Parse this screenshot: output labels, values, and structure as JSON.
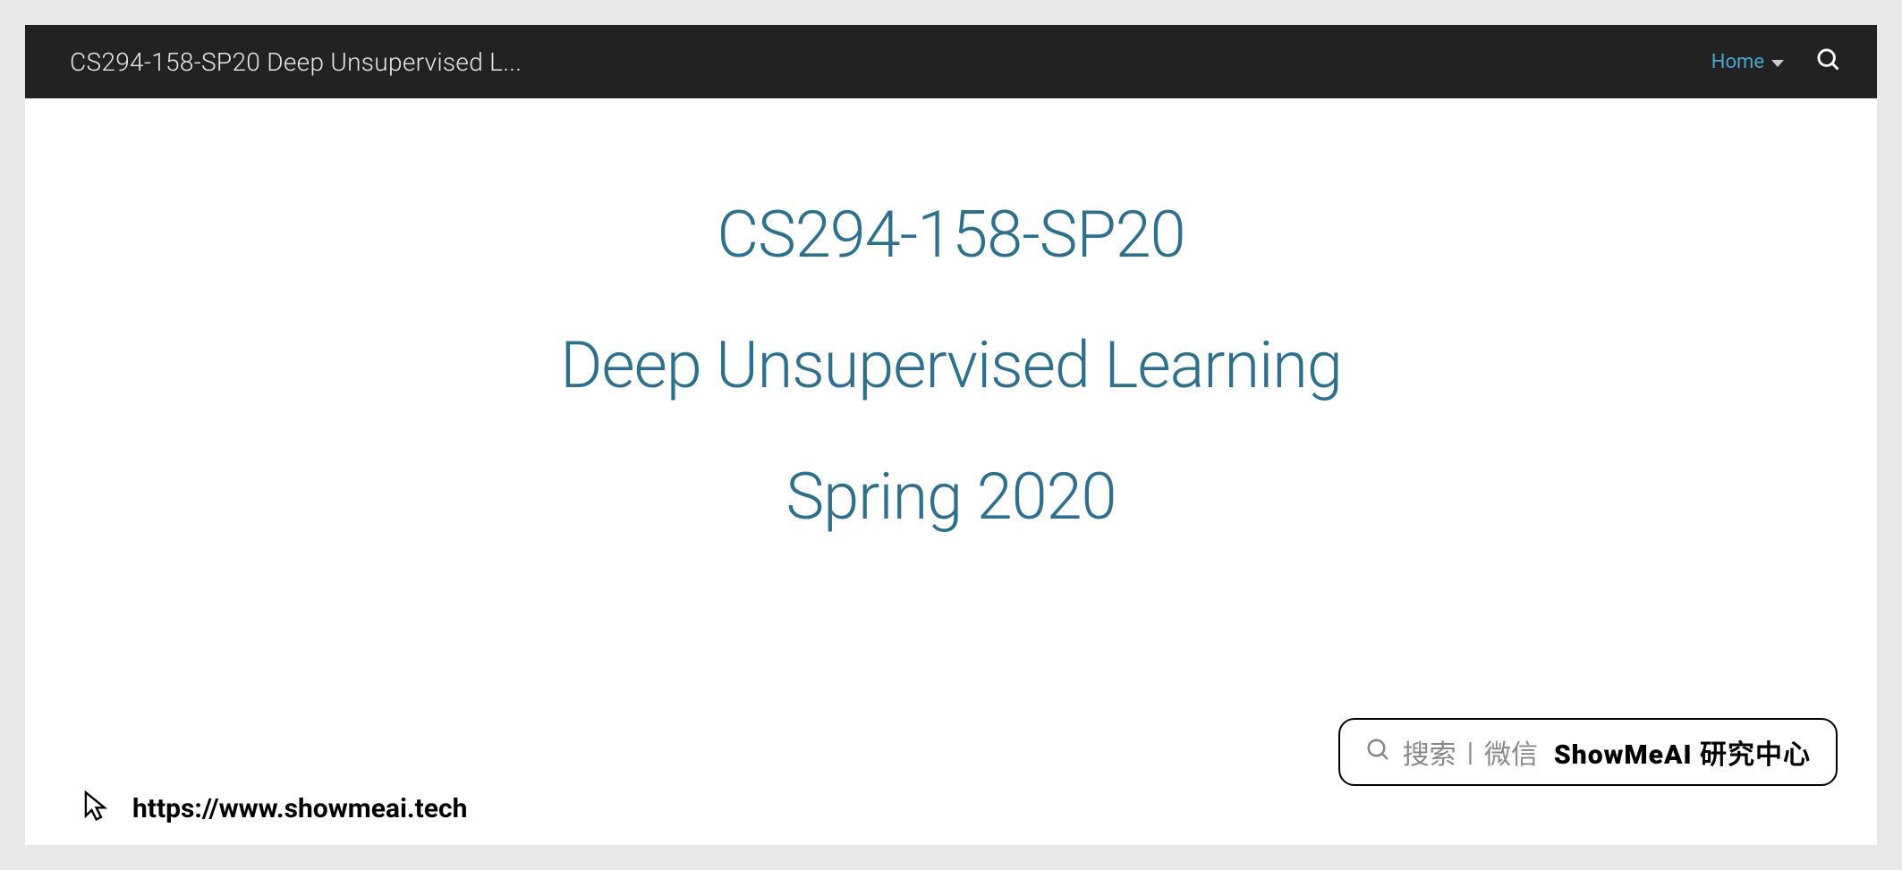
{
  "header": {
    "site_title": "CS294-158-SP20 Deep Unsupervised L...",
    "nav_home": "Home"
  },
  "content": {
    "line1": "CS294-158-SP20",
    "line2": "Deep Unsupervised Learning",
    "line3": "Spring 2020"
  },
  "watermark": {
    "url": "https://www.showmeai.tech"
  },
  "badge": {
    "search_label": "搜索",
    "wechat_label": "微信",
    "brand": "ShowMeAI 研究中心"
  }
}
